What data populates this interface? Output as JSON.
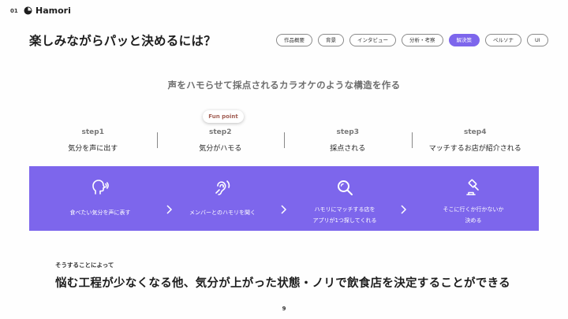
{
  "header": {
    "slide_number": "01",
    "brand": "Hamori",
    "title": "楽しみながらパッと決めるには？"
  },
  "tabs": [
    {
      "label": "作品概要",
      "active": false
    },
    {
      "label": "背景",
      "active": false
    },
    {
      "label": "インタビュー",
      "active": false
    },
    {
      "label": "分析・考察",
      "active": false
    },
    {
      "label": "解決策",
      "active": true
    },
    {
      "label": "ペルソナ",
      "active": false
    },
    {
      "label": "UI",
      "active": false
    }
  ],
  "subtitle": "声をハモらせて採点されるカラオケのような構造を作る",
  "fun_point": "Fun point",
  "steps": [
    {
      "num": "step1",
      "label": "気分を声に出す"
    },
    {
      "num": "step2",
      "label": "気分がハモる"
    },
    {
      "num": "step3",
      "label": "採点される"
    },
    {
      "num": "step4",
      "label": "マッチするお店が紹介される"
    }
  ],
  "flow": [
    {
      "icon": "speaking-head-icon",
      "lines": [
        "食べたい気分を声に表す"
      ]
    },
    {
      "icon": "ear-icon",
      "lines": [
        "メンバーとのハモリを聞く"
      ]
    },
    {
      "icon": "search-icon",
      "lines": [
        "ハモリにマッチする店を",
        "アプリが1つ探してくれる"
      ]
    },
    {
      "icon": "gavel-icon",
      "lines": [
        "そこに行くか行かないか",
        "決める"
      ]
    }
  ],
  "lead": "そうすることによって",
  "conclusion": "悩む工程が少なくなる他、気分が上がった状態・ノリで飲食店を決定することができる",
  "page_number": "9",
  "colors": {
    "accent": "#7d66ec",
    "fun_point": "#a15d52"
  }
}
